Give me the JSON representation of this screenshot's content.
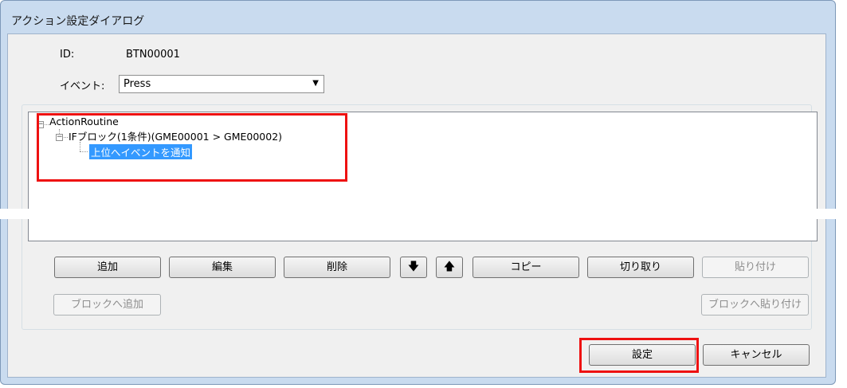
{
  "window": {
    "title": "アクション設定ダイアログ"
  },
  "fields": {
    "id_label": "ID:",
    "id_value": "BTN00001",
    "event_label": "イベント:",
    "event_value": "Press"
  },
  "tree": {
    "root": {
      "toggle": "−",
      "label": "ActionRoutine"
    },
    "child": {
      "toggle": "−",
      "label": "IFブロック(1条件)(GME00001 > GME00002)"
    },
    "leaf": {
      "label": "上位へイベントを通知"
    }
  },
  "buttons": {
    "add": "追加",
    "edit": "編集",
    "delete": "削除",
    "down": "🡇",
    "up": "🡅",
    "copy": "コピー",
    "cut": "切り取り",
    "paste": "貼り付け",
    "add_to_block": "ブロックへ追加",
    "paste_to_block": "ブロックへ貼り付け",
    "ok": "設定",
    "cancel": "キャンセル"
  },
  "colors": {
    "highlight": "#e11111",
    "selection": "#3399ff"
  }
}
